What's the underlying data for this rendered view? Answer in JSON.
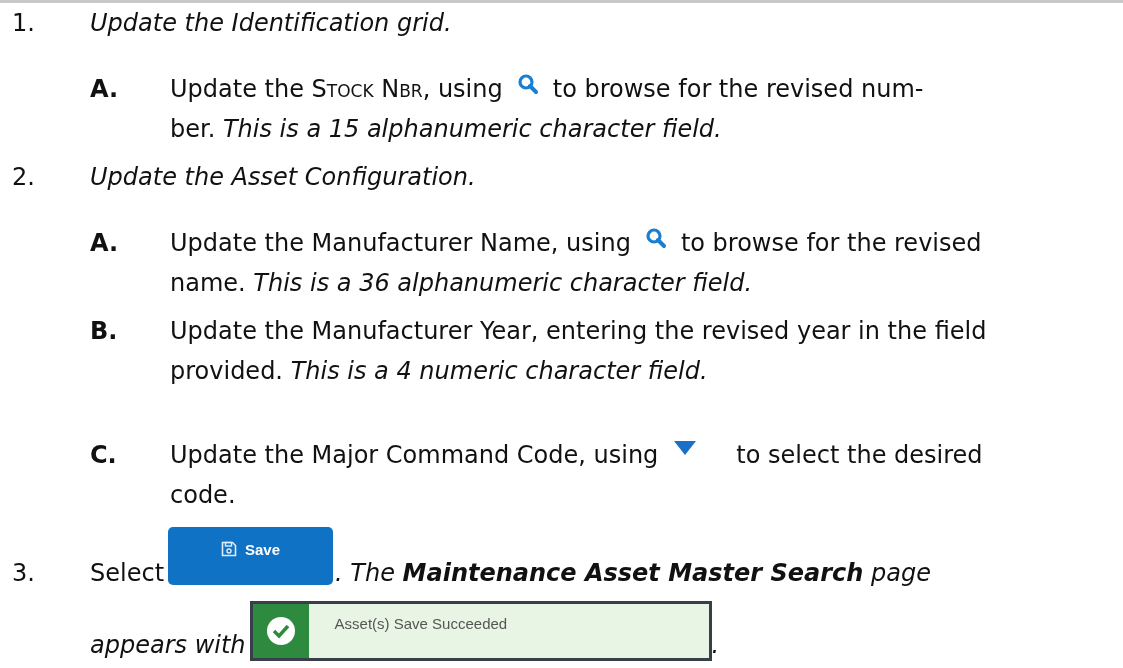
{
  "steps": [
    {
      "number": "1.",
      "lines": [
        [
          {
            "kind": "emphasis",
            "text": "Update the Identification grid."
          }
        ]
      ],
      "substeps": [
        {
          "letter": "A.",
          "lines": [
            [
              {
                "kind": "text",
                "text": "Update the "
              },
              {
                "kind": "small-caps",
                "text": "Stock Nbr"
              },
              {
                "kind": "text",
                "text": ", using"
              },
              {
                "kind": "search"
              },
              {
                "kind": "text",
                "text": "to browse for the revised num-"
              }
            ],
            [
              {
                "kind": "text",
                "text": "ber. "
              },
              {
                "kind": "emphasis",
                "text": "This is a 15 alphanumeric character field."
              }
            ]
          ]
        }
      ]
    },
    {
      "number": "2.",
      "lines": [
        [
          {
            "kind": "emphasis",
            "text": "Update the Asset Configuration."
          }
        ]
      ],
      "substeps": [
        {
          "letter": "A.",
          "lines": [
            [
              {
                "kind": "text",
                "text": "Update the Manufacturer Name, using"
              },
              {
                "kind": "search"
              },
              {
                "kind": "text",
                "text": "to browse for the revised"
              }
            ],
            [
              {
                "kind": "text",
                "text": "name. "
              },
              {
                "kind": "emphasis",
                "text": "This is a 36 alphanumeric character field."
              }
            ]
          ]
        },
        {
          "letter": "B.",
          "lines": [
            [
              {
                "kind": "text",
                "text": "Update the Manufacturer Year, entering the revised year in the field"
              }
            ],
            [
              {
                "kind": "text",
                "text": "provided. "
              },
              {
                "kind": "emphasis",
                "text": "This is a 4 numeric character field."
              }
            ]
          ]
        },
        {
          "letter": "C.",
          "lines": [
            [
              {
                "kind": "text",
                "text": "Update the Major Command Code, using"
              },
              {
                "kind": "dropdown"
              },
              {
                "kind": "text",
                "text": "to select the desired"
              }
            ],
            [
              {
                "kind": "text",
                "text": "code."
              }
            ]
          ]
        }
      ]
    },
    {
      "number": "3.",
      "lines": [
        [
          {
            "kind": "text",
            "text": "Select"
          },
          {
            "kind": "button",
            "text": "Save"
          },
          {
            "kind": "emphasis",
            "text": ". The "
          },
          {
            "kind": "strong-emphasis",
            "text": "Maintenance Asset Master Search"
          },
          {
            "kind": "emphasis",
            "text": " page"
          }
        ],
        [
          {
            "kind": "emphasis",
            "text": "appears with"
          },
          {
            "kind": "banner",
            "text": "Asset(s) Save Succeeded"
          },
          {
            "kind": "emphasis",
            "text": "."
          }
        ]
      ]
    }
  ]
}
